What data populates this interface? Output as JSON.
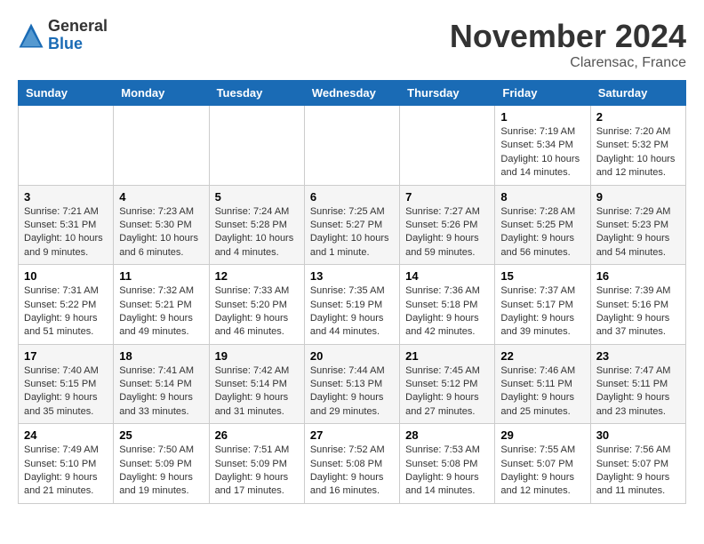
{
  "logo": {
    "general": "General",
    "blue": "Blue"
  },
  "title": "November 2024",
  "location": "Clarensac, France",
  "days_of_week": [
    "Sunday",
    "Monday",
    "Tuesday",
    "Wednesday",
    "Thursday",
    "Friday",
    "Saturday"
  ],
  "weeks": [
    [
      {
        "day": "",
        "info": ""
      },
      {
        "day": "",
        "info": ""
      },
      {
        "day": "",
        "info": ""
      },
      {
        "day": "",
        "info": ""
      },
      {
        "day": "",
        "info": ""
      },
      {
        "day": "1",
        "info": "Sunrise: 7:19 AM\nSunset: 5:34 PM\nDaylight: 10 hours and 14 minutes."
      },
      {
        "day": "2",
        "info": "Sunrise: 7:20 AM\nSunset: 5:32 PM\nDaylight: 10 hours and 12 minutes."
      }
    ],
    [
      {
        "day": "3",
        "info": "Sunrise: 7:21 AM\nSunset: 5:31 PM\nDaylight: 10 hours and 9 minutes."
      },
      {
        "day": "4",
        "info": "Sunrise: 7:23 AM\nSunset: 5:30 PM\nDaylight: 10 hours and 6 minutes."
      },
      {
        "day": "5",
        "info": "Sunrise: 7:24 AM\nSunset: 5:28 PM\nDaylight: 10 hours and 4 minutes."
      },
      {
        "day": "6",
        "info": "Sunrise: 7:25 AM\nSunset: 5:27 PM\nDaylight: 10 hours and 1 minute."
      },
      {
        "day": "7",
        "info": "Sunrise: 7:27 AM\nSunset: 5:26 PM\nDaylight: 9 hours and 59 minutes."
      },
      {
        "day": "8",
        "info": "Sunrise: 7:28 AM\nSunset: 5:25 PM\nDaylight: 9 hours and 56 minutes."
      },
      {
        "day": "9",
        "info": "Sunrise: 7:29 AM\nSunset: 5:23 PM\nDaylight: 9 hours and 54 minutes."
      }
    ],
    [
      {
        "day": "10",
        "info": "Sunrise: 7:31 AM\nSunset: 5:22 PM\nDaylight: 9 hours and 51 minutes."
      },
      {
        "day": "11",
        "info": "Sunrise: 7:32 AM\nSunset: 5:21 PM\nDaylight: 9 hours and 49 minutes."
      },
      {
        "day": "12",
        "info": "Sunrise: 7:33 AM\nSunset: 5:20 PM\nDaylight: 9 hours and 46 minutes."
      },
      {
        "day": "13",
        "info": "Sunrise: 7:35 AM\nSunset: 5:19 PM\nDaylight: 9 hours and 44 minutes."
      },
      {
        "day": "14",
        "info": "Sunrise: 7:36 AM\nSunset: 5:18 PM\nDaylight: 9 hours and 42 minutes."
      },
      {
        "day": "15",
        "info": "Sunrise: 7:37 AM\nSunset: 5:17 PM\nDaylight: 9 hours and 39 minutes."
      },
      {
        "day": "16",
        "info": "Sunrise: 7:39 AM\nSunset: 5:16 PM\nDaylight: 9 hours and 37 minutes."
      }
    ],
    [
      {
        "day": "17",
        "info": "Sunrise: 7:40 AM\nSunset: 5:15 PM\nDaylight: 9 hours and 35 minutes."
      },
      {
        "day": "18",
        "info": "Sunrise: 7:41 AM\nSunset: 5:14 PM\nDaylight: 9 hours and 33 minutes."
      },
      {
        "day": "19",
        "info": "Sunrise: 7:42 AM\nSunset: 5:14 PM\nDaylight: 9 hours and 31 minutes."
      },
      {
        "day": "20",
        "info": "Sunrise: 7:44 AM\nSunset: 5:13 PM\nDaylight: 9 hours and 29 minutes."
      },
      {
        "day": "21",
        "info": "Sunrise: 7:45 AM\nSunset: 5:12 PM\nDaylight: 9 hours and 27 minutes."
      },
      {
        "day": "22",
        "info": "Sunrise: 7:46 AM\nSunset: 5:11 PM\nDaylight: 9 hours and 25 minutes."
      },
      {
        "day": "23",
        "info": "Sunrise: 7:47 AM\nSunset: 5:11 PM\nDaylight: 9 hours and 23 minutes."
      }
    ],
    [
      {
        "day": "24",
        "info": "Sunrise: 7:49 AM\nSunset: 5:10 PM\nDaylight: 9 hours and 21 minutes."
      },
      {
        "day": "25",
        "info": "Sunrise: 7:50 AM\nSunset: 5:09 PM\nDaylight: 9 hours and 19 minutes."
      },
      {
        "day": "26",
        "info": "Sunrise: 7:51 AM\nSunset: 5:09 PM\nDaylight: 9 hours and 17 minutes."
      },
      {
        "day": "27",
        "info": "Sunrise: 7:52 AM\nSunset: 5:08 PM\nDaylight: 9 hours and 16 minutes."
      },
      {
        "day": "28",
        "info": "Sunrise: 7:53 AM\nSunset: 5:08 PM\nDaylight: 9 hours and 14 minutes."
      },
      {
        "day": "29",
        "info": "Sunrise: 7:55 AM\nSunset: 5:07 PM\nDaylight: 9 hours and 12 minutes."
      },
      {
        "day": "30",
        "info": "Sunrise: 7:56 AM\nSunset: 5:07 PM\nDaylight: 9 hours and 11 minutes."
      }
    ]
  ]
}
